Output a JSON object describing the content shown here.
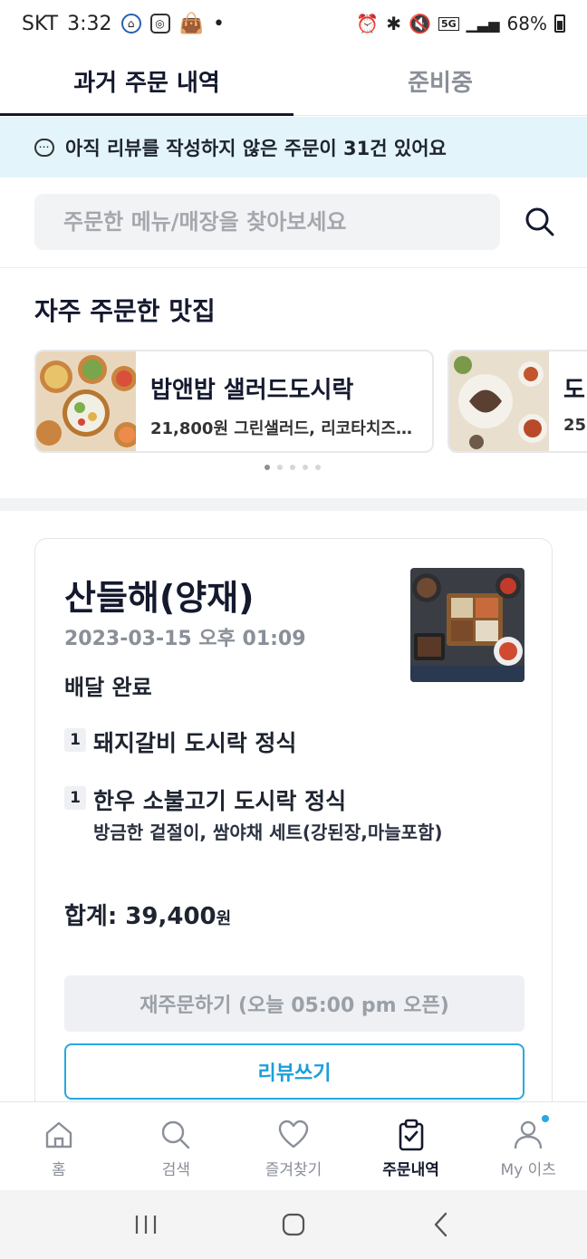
{
  "status_bar": {
    "carrier": "SKT",
    "time": "3:32",
    "battery": "68%",
    "network": "5G"
  },
  "tabs": [
    {
      "label": "과거 주문 내역",
      "active": true
    },
    {
      "label": "준비중",
      "active": false
    }
  ],
  "banner": {
    "text": "아직 리뷰를 작성하지 않은 주문이 31건 있어요"
  },
  "search": {
    "placeholder": "주문한 메뉴/매장을 찾아보세요"
  },
  "frequent": {
    "title": "자주 주문한 맛집",
    "items": [
      {
        "name": "밥앤밥 샐러드도시락",
        "desc": "21,800원 그린샐러드, 리코타치즈…"
      },
      {
        "name": "도",
        "desc": "25,"
      }
    ],
    "page_index": 1,
    "page_count": 5
  },
  "order": {
    "store": "산들해(양재)",
    "date": "2023-03-15 오후 01:09",
    "status": "배달 완료",
    "items": [
      {
        "qty": "1",
        "name": "돼지갈비 도시락 정식",
        "option": ""
      },
      {
        "qty": "1",
        "name": "한우 소불고기 도시락 정식",
        "option": "방금한 겉절이, 쌈야채 세트(강된장,마늘포함)"
      }
    ],
    "total_label": "합계: 39,400",
    "total_unit": "원",
    "reorder_label": "재주문하기 (오늘 05:00 pm 오픈)",
    "review_label": "리뷰쓰기"
  },
  "bottom_nav": [
    {
      "label": "홈",
      "icon": "home-icon",
      "active": false
    },
    {
      "label": "검색",
      "icon": "search-icon",
      "active": false
    },
    {
      "label": "즐겨찾기",
      "icon": "heart-icon",
      "active": false
    },
    {
      "label": "주문내역",
      "icon": "clipboard-check-icon",
      "active": true
    },
    {
      "label": "My 이츠",
      "icon": "person-icon",
      "active": false
    }
  ],
  "colors": {
    "accent": "#27a8e0",
    "banner_bg": "#e3f4fb",
    "primary_text": "#14192e"
  }
}
